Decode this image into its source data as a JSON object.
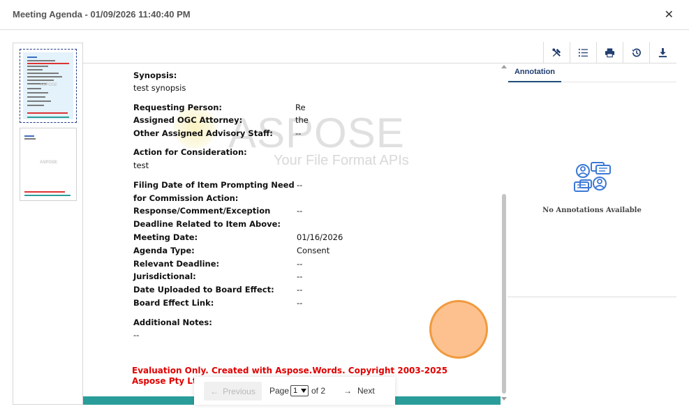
{
  "header": {
    "title": "Meeting Agenda - 01/09/2026 11:40:40 PM",
    "close_glyph": "✕"
  },
  "toolbar": {
    "buttons": [
      {
        "icon": "tools-icon"
      },
      {
        "icon": "list-icon"
      },
      {
        "icon": "print-icon"
      },
      {
        "icon": "history-icon"
      },
      {
        "icon": "download-icon"
      }
    ]
  },
  "thumbnails": {
    "watermark": "ASPOSE",
    "pages": [
      1,
      2
    ],
    "selected": 1
  },
  "document": {
    "watermark": "ASPOSE",
    "watermark_sub": "Your File Format APIs",
    "synopsis_label": "Synopsis:",
    "synopsis_value": "test synopsis",
    "requesting_person_label": "Requesting Person:",
    "requesting_person_value": "Re",
    "ogc_attorney_label": "Assigned OGC Attorney:",
    "ogc_attorney_value": "the",
    "advisory_staff_label": "Other Assigned Advisory Staff:",
    "advisory_staff_value": "--",
    "action_label": "Action for Consideration:",
    "action_value": "test",
    "filing_date_label_1": "Filing Date of Item Prompting Need",
    "filing_date_label_2": "for Commission Action:",
    "filing_date_value": "--",
    "response_label_1": "Response/Comment/Exception",
    "response_label_2": "Deadline Related to Item Above:",
    "response_value": "--",
    "meeting_date_label": "Meeting Date:",
    "meeting_date_value": "01/16/2026",
    "agenda_type_label": "Agenda Type:",
    "agenda_type_value": "Consent",
    "relevant_deadline_label": "Relevant Deadline:",
    "relevant_deadline_value": "--",
    "jurisdictional_label": "Jurisdictional:",
    "jurisdictional_value": "--",
    "date_uploaded_label": "Date Uploaded to Board Effect:",
    "date_uploaded_value": "--",
    "board_link_label": "Board Effect Link:",
    "board_link_value": "--",
    "additional_notes_label": "Additional Notes:",
    "additional_notes_value": "--",
    "evaluation_line_1": "Evaluation Only. Created with Aspose.Words. Copyright 2003-2025",
    "evaluation_line_2": "Aspose Pty Lt"
  },
  "pager": {
    "previous_label": "Previous",
    "page_label": "Page",
    "current_page": "1",
    "of_label": "of 2",
    "next_label": "Next"
  },
  "annotation": {
    "tab_label": "Annotation",
    "empty_text": "No Annotations Available"
  },
  "colors": {
    "teal": "#2a9d9b",
    "evaluation_red": "#e00000",
    "annotation_blue": "#1f4e79",
    "touch_orange": "#f09a3e"
  }
}
